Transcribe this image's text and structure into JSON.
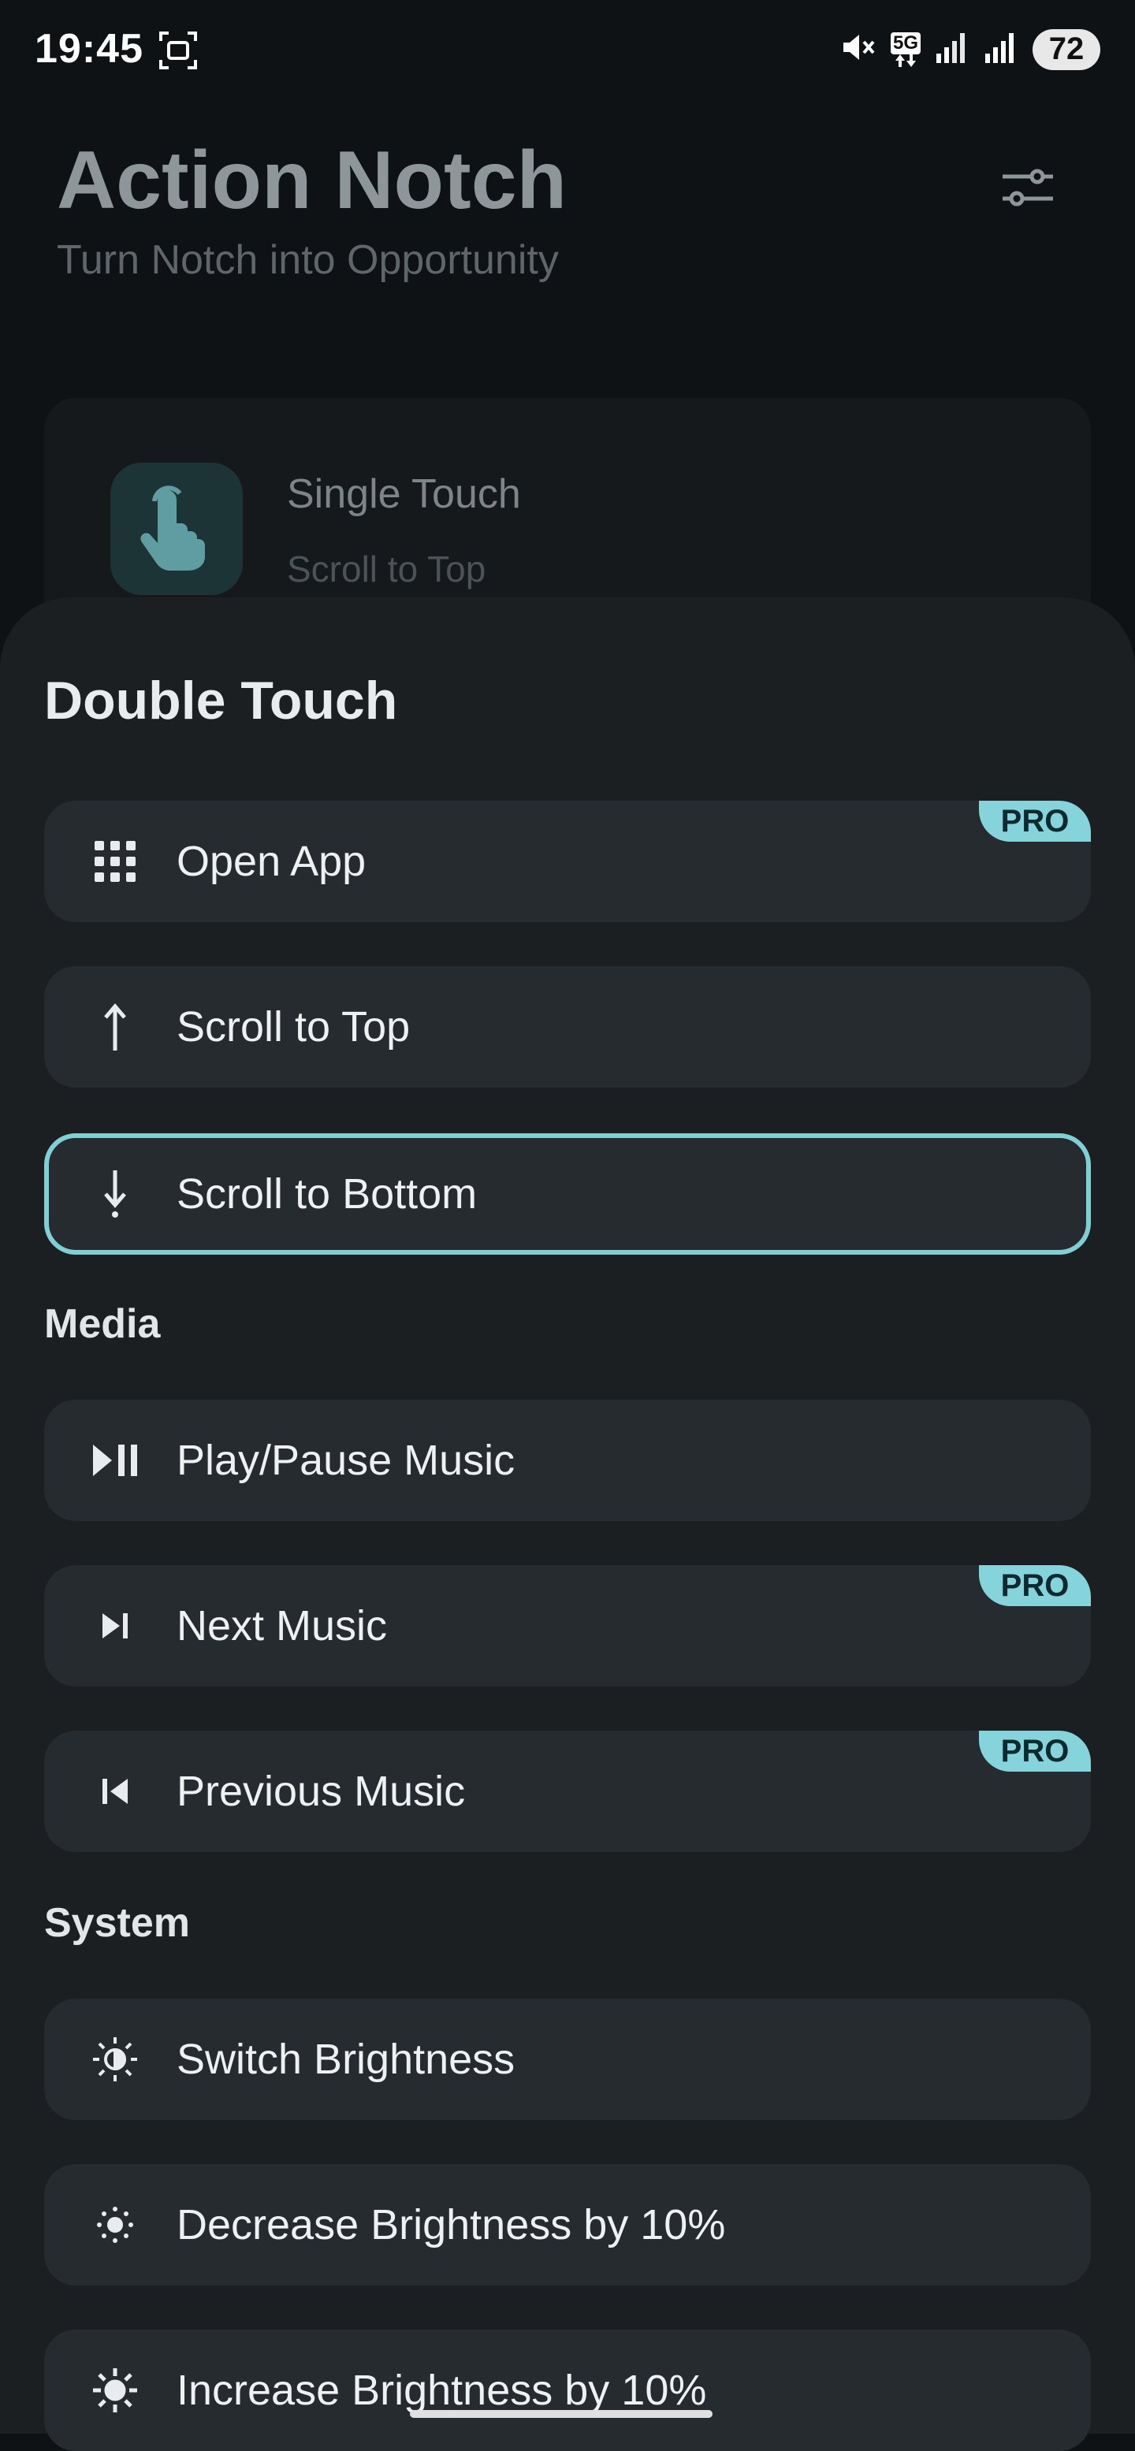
{
  "status_bar": {
    "time": "19:45",
    "network": "5G",
    "battery": "72"
  },
  "header": {
    "title": "Action Notch",
    "subtitle": "Turn Notch into Opportunity"
  },
  "background_card": {
    "title": "Single Touch",
    "subtitle": "Scroll to Top"
  },
  "sheet": {
    "title": "Double Touch",
    "pro_label": "PRO",
    "general_options": [
      {
        "label": "Open App",
        "icon": "grid-icon",
        "pro": true
      },
      {
        "label": "Scroll to Top",
        "icon": "arrow-up-icon",
        "pro": false
      },
      {
        "label": "Scroll to Bottom",
        "icon": "arrow-down-icon",
        "pro": false,
        "selected": true
      }
    ],
    "media_label": "Media",
    "media_options": [
      {
        "label": "Play/Pause Music",
        "icon": "play-pause-icon",
        "pro": false
      },
      {
        "label": "Next Music",
        "icon": "skip-next-icon",
        "pro": true
      },
      {
        "label": "Previous Music",
        "icon": "skip-previous-icon",
        "pro": true
      }
    ],
    "system_label": "System",
    "system_options": [
      {
        "label": "Switch Brightness",
        "icon": "brightness-half-icon",
        "pro": false
      },
      {
        "label": "Decrease Brightness by 10%",
        "icon": "brightness-low-icon",
        "pro": false
      },
      {
        "label": "Increase Brightness by 10%",
        "icon": "brightness-high-icon",
        "pro": false
      }
    ]
  },
  "colors": {
    "accent": "#85d3db",
    "sheet_bg": "#1b1f22",
    "option_bg": "#262b2f"
  }
}
